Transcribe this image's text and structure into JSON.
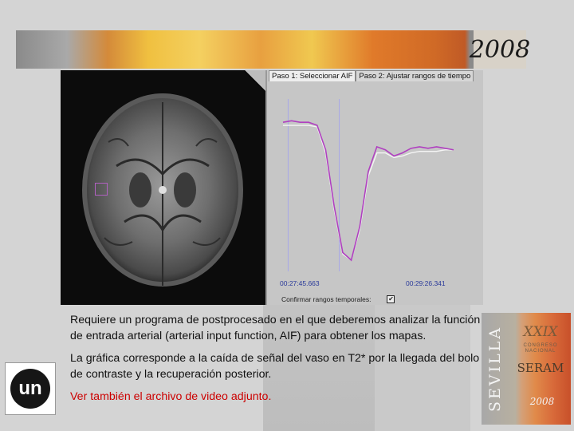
{
  "banner": {
    "year": "2008"
  },
  "viewer": {
    "tabs": [
      {
        "label": "Paso 1: Seleccionar AIF",
        "active": true
      },
      {
        "label": "Paso 2: Ajustar rangos de tiempo",
        "active": false
      }
    ],
    "time_start": "00:27:45.663",
    "time_end": "00:29:26.341",
    "checkbox_label": "Confirmar rangos temporales:",
    "checkbox_checked": true,
    "checkbox_mark": "✔",
    "colors": {
      "curve_measured": "#b040c0",
      "curve_fit": "#f4f4f4",
      "time_marker": "#a8a8e8"
    }
  },
  "body": {
    "paragraph1": "Requiere un programa de postprocesado en el que deberemos analizar la función de entrada arterial (arterial input function, AIF) para obtener los mapas.",
    "paragraph2": "La gráfica corresponde a la caída de señal del vaso en T2* por la llegada del bolo de contraste y la recuperación posterior.",
    "paragraph3": "Ver también el archivo de video adjunto."
  },
  "logo": {
    "text": "un"
  },
  "poster": {
    "city": "SEVILLA",
    "edition": "XXIX",
    "subtitle": "CONGRESO NACIONAL",
    "society": "SERAM",
    "year": "2008"
  },
  "chart_data": {
    "type": "line",
    "title": "",
    "xlabel": "",
    "ylabel": "",
    "x": [
      0,
      5,
      10,
      15,
      20,
      25,
      30,
      35,
      40,
      45,
      50,
      55,
      60,
      65,
      70,
      75,
      80,
      85,
      90,
      95,
      100
    ],
    "series": [
      {
        "values": [
          0.9,
          0.91,
          0.9,
          0.9,
          0.88,
          0.72,
          0.35,
          0.05,
          0.0,
          0.22,
          0.58,
          0.74,
          0.72,
          0.68,
          0.7,
          0.73,
          0.74,
          0.73,
          0.74,
          0.73,
          0.72
        ]
      },
      {
        "values": [
          0.88,
          0.88,
          0.88,
          0.88,
          0.87,
          0.7,
          0.33,
          0.04,
          0.0,
          0.2,
          0.55,
          0.7,
          0.7,
          0.67,
          0.68,
          0.7,
          0.71,
          0.71,
          0.71,
          0.72,
          0.72
        ]
      }
    ],
    "grid": false
  }
}
